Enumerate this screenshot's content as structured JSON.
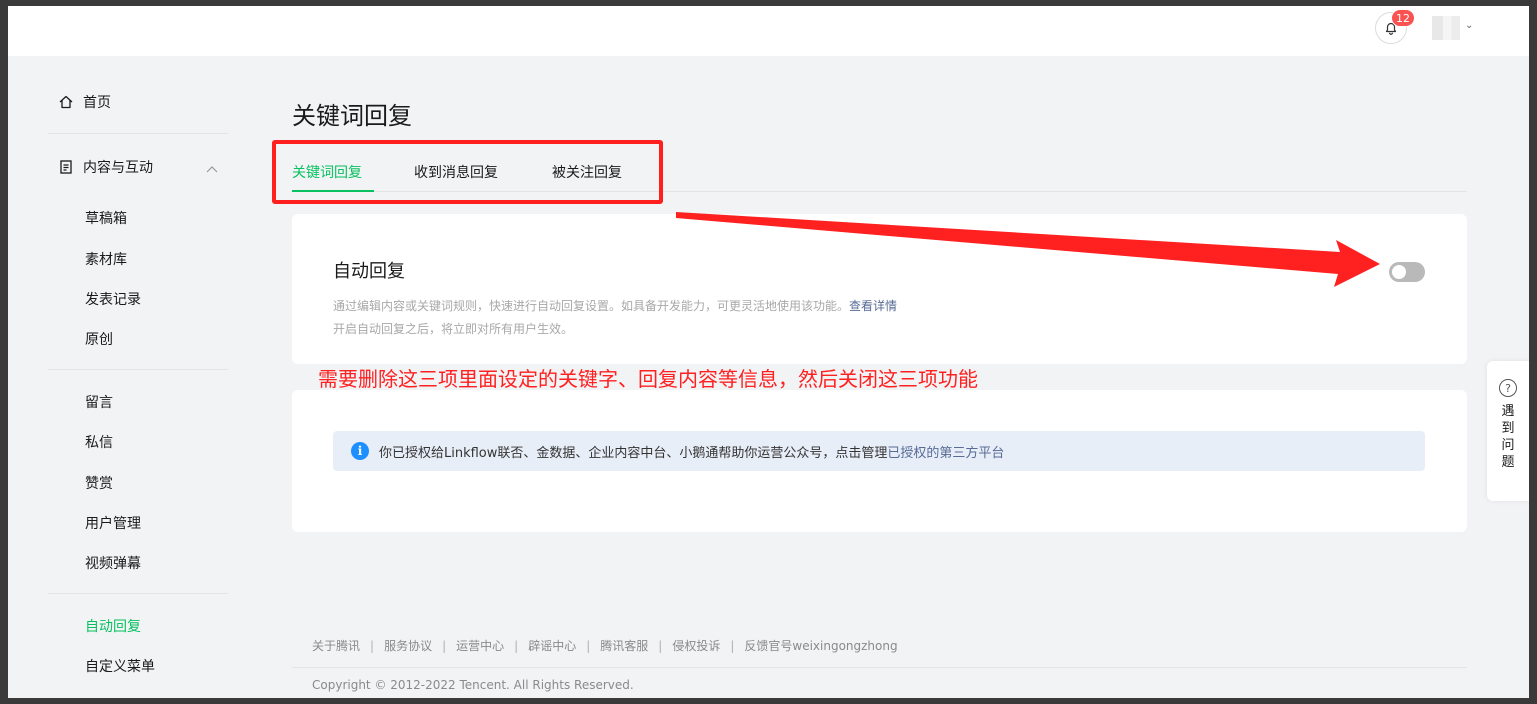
{
  "topbar": {
    "notification_count": "12",
    "avatar_caret": "⌄"
  },
  "sidebar": {
    "home": "首页",
    "content_section": "内容与互动",
    "content_items": [
      "草稿箱",
      "素材库",
      "发表记录",
      "原创"
    ],
    "interact_items": [
      "留言",
      "私信",
      "赞赏",
      "用户管理",
      "视频弹幕"
    ],
    "bottom_items": [
      "自动回复",
      "自定义菜单"
    ],
    "active_item": "自动回复"
  },
  "main": {
    "title": "关键词回复",
    "tabs": [
      "关键词回复",
      "收到消息回复",
      "被关注回复"
    ],
    "active_tab": "关键词回复"
  },
  "auto_reply": {
    "title": "自动回复",
    "desc_line1": "通过编辑内容或关键词规则，快速进行自动回复设置。如具备开发能力，可更灵活地使用该功能。",
    "desc_link": "查看详情",
    "desc_line2": "开启自动回复之后，将立即对所有用户生效。",
    "toggle_on": false
  },
  "annotation": {
    "text": "需要删除这三项里面设定的关键字、回复内容等信息，然后关闭这三项功能",
    "color": "#ff2020"
  },
  "auth_notice": {
    "icon": "i",
    "text": "你已授权给Linkflow联否、金数据、企业内容中台、小鹅通帮助你运营公众号，点击管理",
    "link": "已授权的第三方平台"
  },
  "help": {
    "icon": "?",
    "chars": [
      "遇",
      "到",
      "问",
      "题"
    ]
  },
  "footer": {
    "links": [
      "关于腾讯",
      "服务协议",
      "运营中心",
      "辟谣中心",
      "腾讯客服",
      "侵权投诉",
      "反馈官号weixingongzhong"
    ],
    "copyright": "Copyright © 2012-2022 Tencent. All Rights Reserved."
  },
  "colors": {
    "accent": "#07c160",
    "link": "#576b95",
    "badge": "#fa5151",
    "highlight": "#ff1f1f"
  }
}
